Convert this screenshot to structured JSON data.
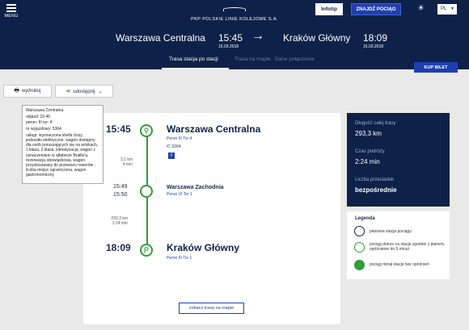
{
  "header": {
    "menu_label": "MENU",
    "logo_text": "PKP POLSKIE LINIE KOLEJOWE S.A.",
    "infotip_label": "Infotip",
    "find_train_label": "ZNAJDŹ POCIĄG",
    "language": "PL"
  },
  "route": {
    "from": "Warszawa Centralna",
    "departure_time": "15:45",
    "departure_date": "15.03.2018",
    "to": "Kraków Główny",
    "arrival_time": "18:09",
    "arrival_date": "15.03.2018"
  },
  "tabs": [
    {
      "label": "Trasa stacja po stacji",
      "active": true
    },
    {
      "label": "Trasa na mapie",
      "active": false
    },
    {
      "label": "Dane połączenia",
      "active": false
    }
  ],
  "buy_ticket_label": "KUP BILET",
  "actions": {
    "print_label": "wydrukuj",
    "share_label": "udostępnij"
  },
  "tooltip": {
    "lines": [
      "Warszawa Centralna",
      "odjazd: 15:45",
      "peron: III tor: 4",
      "nr wyjazdowy: 5364",
      "usługi: wyznaczona strefa ciszy, jednostki elektryczne, wagon dostępny dla osób poruszających się na wózkach, 1 klasa, 2 klasa, klimatyzacja, wagon z oznaczeniami w alfabecie Braille'a, rezerwacja obowiązkowa, wagon przystosowany do przewozu rowerów - liczba miejsc ograniczona, wagon gastronomiczny"
    ]
  },
  "stations": [
    {
      "time": "15:45",
      "name": "Warszawa Centralna",
      "peron": "Peron III Tor 4",
      "train": "IC 5364"
    },
    {
      "time_arr": "15:49",
      "time_dep": "15:50",
      "name": "Warszawa Zachodnia",
      "peron": "Peron VI Tor 1"
    },
    {
      "time": "18:09",
      "name": "Kraków Główny",
      "peron": "Peron III Tor 1"
    }
  ],
  "segments": [
    {
      "distance": "3,1 km",
      "duration": "4 min"
    },
    {
      "distance": "293,3 km",
      "duration": "2:24 min"
    }
  ],
  "map_button_label": "zobacz trasę na mapie",
  "summary": {
    "length_label": "Długość całej trasy",
    "length_value": "293,3 km",
    "duration_label": "Czas podróży",
    "duration_value": "2:24 min",
    "transfers_label": "Liczba przesiadek",
    "transfers_value": "bezpośrednie"
  },
  "legend": {
    "title": "Legenda",
    "items": [
      "planowa stacja pociągu",
      "pociąg dotrze na stacje zgodnie z planem, opóźnienie do 5 minut",
      "pociąg minął stacje bez opóźnień"
    ]
  },
  "colors": {
    "navy": "#0e2249",
    "accent_blue": "#1f3fb0",
    "green": "#2e9d3a"
  }
}
